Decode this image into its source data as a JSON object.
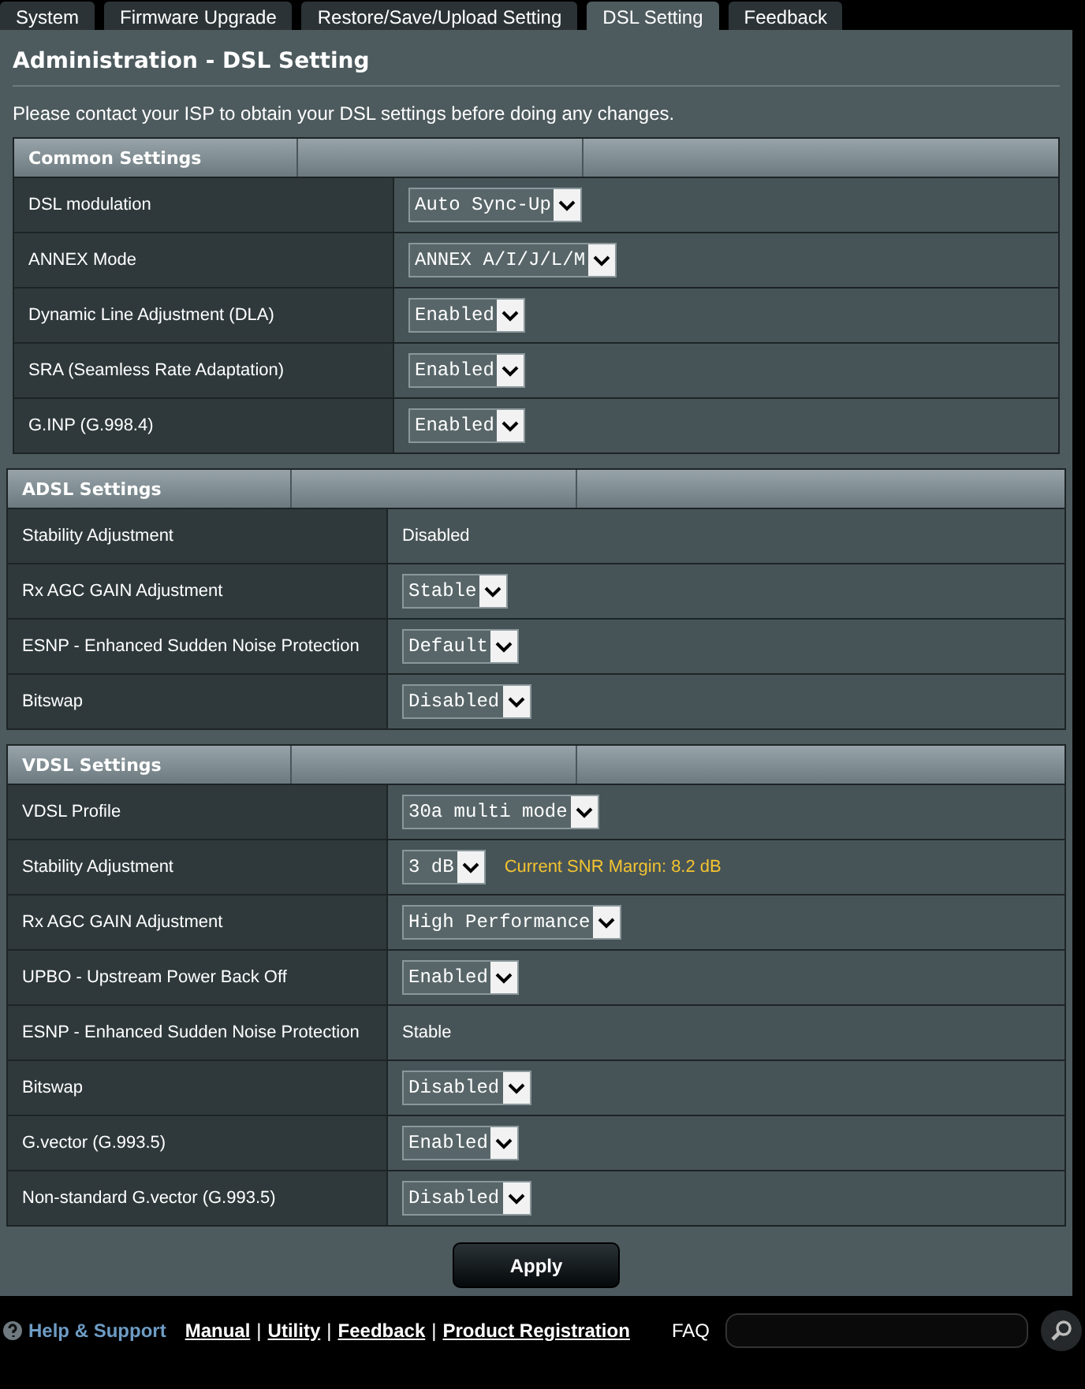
{
  "tabs": [
    {
      "label": "System",
      "selected": false
    },
    {
      "label": "Firmware Upgrade",
      "selected": false
    },
    {
      "label": "Restore/Save/Upload Setting",
      "selected": false
    },
    {
      "label": "DSL Setting",
      "selected": true
    },
    {
      "label": "Feedback",
      "selected": false
    }
  ],
  "title": "Administration - DSL Setting",
  "notice": "Please contact your ISP to obtain your DSL settings before doing any changes.",
  "sections": [
    {
      "title": "Common Settings",
      "rows": [
        {
          "label": "DSL modulation",
          "kind": "select",
          "value": "Auto Sync-Up"
        },
        {
          "label": "ANNEX Mode",
          "kind": "select",
          "value": "ANNEX A/I/J/L/M"
        },
        {
          "label": "Dynamic Line Adjustment (DLA)",
          "kind": "select",
          "value": "Enabled"
        },
        {
          "label": "SRA (Seamless Rate Adaptation)",
          "kind": "select",
          "value": "Enabled"
        },
        {
          "label": "G.INP (G.998.4)",
          "kind": "select",
          "value": "Enabled"
        }
      ]
    },
    {
      "title": "ADSL Settings",
      "rows": [
        {
          "label": "Stability Adjustment",
          "kind": "text",
          "value": "Disabled"
        },
        {
          "label": "Rx AGC GAIN Adjustment",
          "kind": "select",
          "value": "Stable"
        },
        {
          "label": "ESNP - Enhanced Sudden Noise Protection",
          "kind": "select",
          "value": "Default"
        },
        {
          "label": "Bitswap",
          "kind": "select",
          "value": "Disabled"
        }
      ]
    },
    {
      "title": "VDSL Settings",
      "rows": [
        {
          "label": "VDSL Profile",
          "kind": "select",
          "value": "30a multi mode"
        },
        {
          "label": "Stability Adjustment",
          "kind": "select",
          "value": "3 dB",
          "note": "Current SNR Margin: 8.2 dB"
        },
        {
          "label": "Rx AGC GAIN Adjustment",
          "kind": "select",
          "value": "High Performance"
        },
        {
          "label": "UPBO - Upstream Power Back Off",
          "kind": "select",
          "value": "Enabled"
        },
        {
          "label": "ESNP - Enhanced Sudden Noise Protection",
          "kind": "text",
          "value": "Stable"
        },
        {
          "label": "Bitswap",
          "kind": "select",
          "value": "Disabled"
        },
        {
          "label": "G.vector (G.993.5)",
          "kind": "select",
          "value": "Enabled"
        },
        {
          "label": "Non-standard G.vector (G.993.5)",
          "kind": "select",
          "value": "Disabled"
        }
      ]
    }
  ],
  "apply_button": "Apply",
  "footer": {
    "help_label": "Help & Support",
    "links": [
      {
        "kind": "link",
        "text": "Manual"
      },
      {
        "kind": "separator",
        "text": "|"
      },
      {
        "kind": "link",
        "text": "Utility"
      },
      {
        "kind": "separator",
        "text": "|"
      },
      {
        "kind": "link",
        "text": "Feedback"
      },
      {
        "kind": "separator",
        "text": "|"
      },
      {
        "kind": "link",
        "text": "Product Registration"
      }
    ],
    "faq_label": "FAQ"
  }
}
